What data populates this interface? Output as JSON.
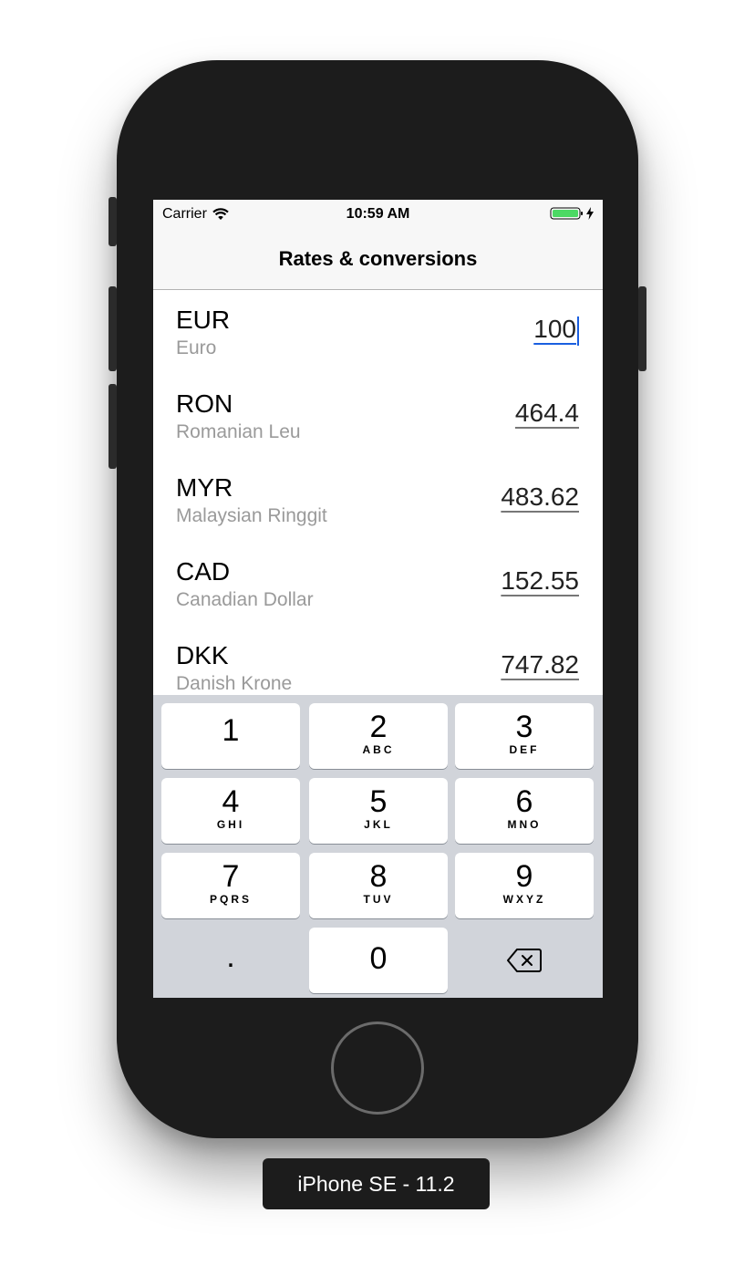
{
  "status_bar": {
    "carrier": "Carrier",
    "time": "10:59 AM",
    "battery_color": "#4cd964"
  },
  "nav": {
    "title": "Rates & conversions"
  },
  "currencies": [
    {
      "code": "EUR",
      "name": "Euro",
      "value": "100",
      "active": true
    },
    {
      "code": "RON",
      "name": "Romanian Leu",
      "value": "464.4"
    },
    {
      "code": "MYR",
      "name": "Malaysian Ringgit",
      "value": "483.62"
    },
    {
      "code": "CAD",
      "name": "Canadian Dollar",
      "value": "152.55"
    },
    {
      "code": "DKK",
      "name": "Danish Krone",
      "value": "747.82"
    }
  ],
  "keypad": {
    "keys": [
      {
        "digit": "1",
        "letters": ""
      },
      {
        "digit": "2",
        "letters": "ABC"
      },
      {
        "digit": "3",
        "letters": "DEF"
      },
      {
        "digit": "4",
        "letters": "GHI"
      },
      {
        "digit": "5",
        "letters": "JKL"
      },
      {
        "digit": "6",
        "letters": "MNO"
      },
      {
        "digit": "7",
        "letters": "PQRS"
      },
      {
        "digit": "8",
        "letters": "TUV"
      },
      {
        "digit": "9",
        "letters": "WXYZ"
      }
    ],
    "decimal": ".",
    "zero": "0",
    "delete_icon": "backspace-icon"
  },
  "simulator": {
    "device_label": "iPhone SE - 11.2"
  }
}
